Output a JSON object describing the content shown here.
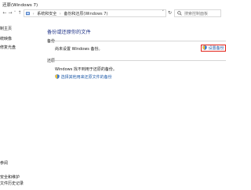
{
  "window": {
    "title": "还原(Windows 7)"
  },
  "nav": {
    "back": "←",
    "forward": "→",
    "recent": "˅",
    "up": "↑",
    "breadcrumbs": [
      "系统和安全",
      "备份和还原(Windows 7)"
    ],
    "separator": "›",
    "refresh": "↻",
    "search_placeholder": "搜索控制面板"
  },
  "sidebar": {
    "items_top": [
      "制主页",
      "统映像",
      "修复光盘"
    ],
    "items_bottom": [
      "参阅",
      "安全和维护",
      "文件历史记录"
    ]
  },
  "main": {
    "heading": "备份或还原你的文件",
    "backup": {
      "label": "备份",
      "status": "尚未设置 Windows 备份。",
      "setup_link": "设置备份"
    },
    "restore": {
      "label": "还原",
      "status": "Windows 找不到用于还原的备份。",
      "select_link": "选择其他用来还原文件的备份"
    }
  },
  "colors": {
    "heading": "#1e3287",
    "link": "#1e5aa8",
    "highlight": "#e2231a"
  }
}
